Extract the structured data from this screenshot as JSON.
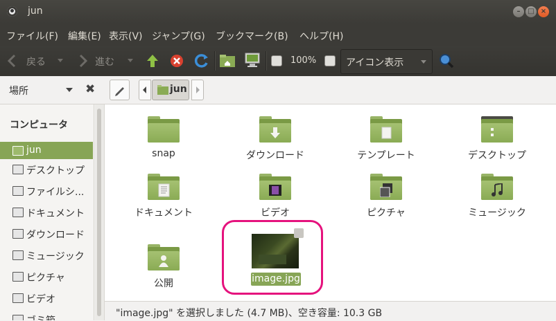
{
  "window": {
    "title": "jun"
  },
  "menu": [
    "ファイル(F)",
    "編集(E)",
    "表示(V)",
    "ジャンプ(G)",
    "ブックマーク(B)",
    "ヘルプ(H)"
  ],
  "toolbar": {
    "back_label": "戻る",
    "forward_label": "進む",
    "zoom_level": "100%",
    "view_mode": "アイコン表示"
  },
  "location": {
    "places_label": "場所",
    "crumb": "jun"
  },
  "sidebar": {
    "heading": "コンピュータ",
    "items": [
      {
        "label": "jun",
        "selected": true
      },
      {
        "label": "デスクトップ"
      },
      {
        "label": "ファイルシ..."
      },
      {
        "label": "ドキュメント"
      },
      {
        "label": "ダウンロード"
      },
      {
        "label": "ミュージック"
      },
      {
        "label": "ピクチャ"
      },
      {
        "label": "ビデオ"
      },
      {
        "label": "ゴミ箱"
      }
    ]
  },
  "files": [
    {
      "name": "snap"
    },
    {
      "name": "ダウンロード"
    },
    {
      "name": "テンプレート"
    },
    {
      "name": "デスクトップ"
    },
    {
      "name": "ドキュメント"
    },
    {
      "name": "ビデオ"
    },
    {
      "name": "ピクチャ"
    },
    {
      "name": "ミュージック"
    },
    {
      "name": "公開"
    },
    {
      "name": "image.jpg"
    }
  ],
  "status": "\"image.jpg\" を選択しました (4.7 MB)、空き容量: 10.3 GB",
  "colors": {
    "accent": "#87a556",
    "highlight_ring": "#e5127d",
    "titlebar": "#3c3b37"
  }
}
